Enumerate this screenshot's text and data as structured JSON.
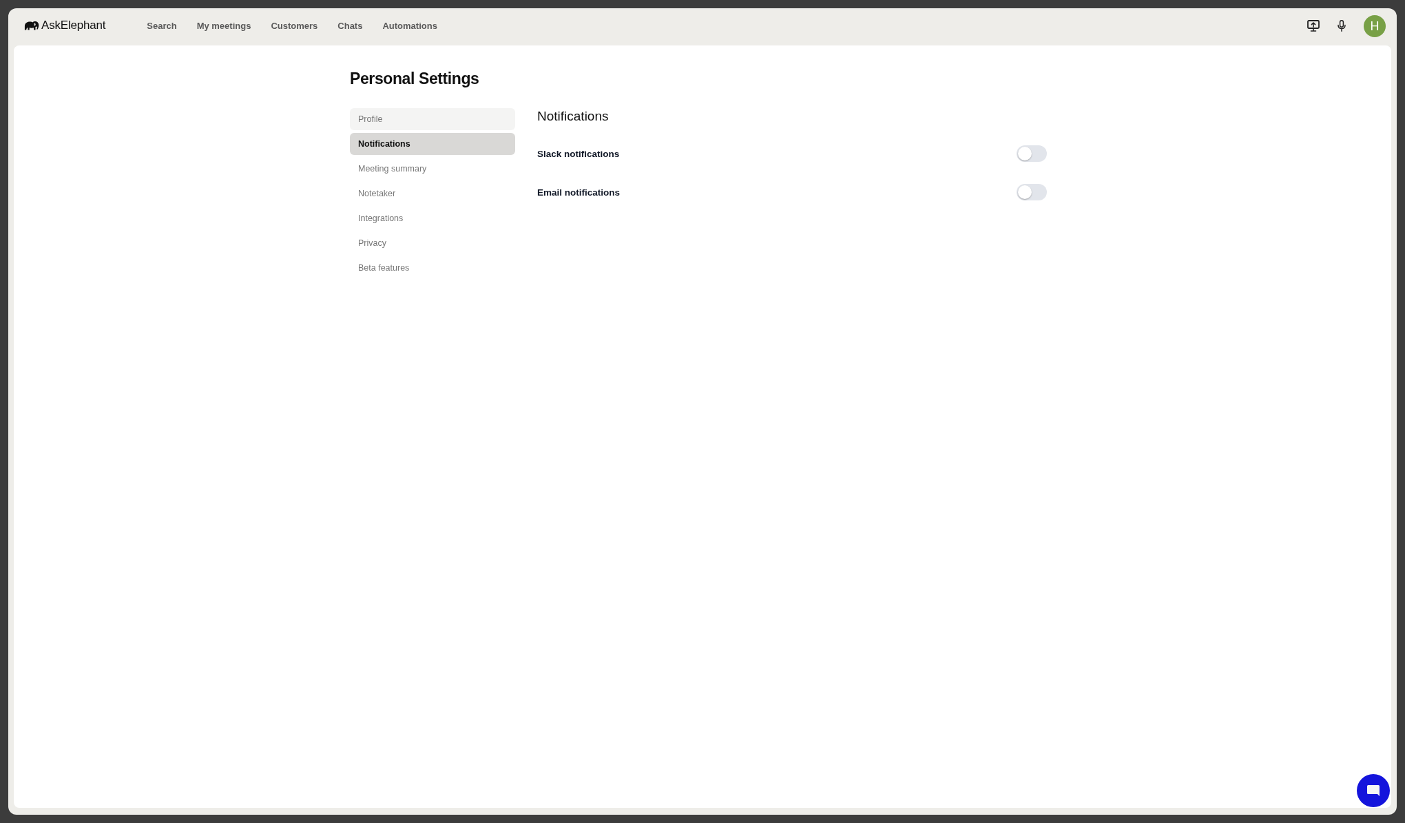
{
  "app": {
    "name": "AskElephant"
  },
  "nav": [
    "Search",
    "My meetings",
    "Customers",
    "Chats",
    "Automations"
  ],
  "user": {
    "initial": "H"
  },
  "page": {
    "title": "Personal Settings"
  },
  "sidebar": {
    "items": [
      {
        "label": "Profile",
        "selected": false,
        "hovered": true
      },
      {
        "label": "Notifications",
        "selected": true,
        "hovered": false
      },
      {
        "label": "Meeting summary",
        "selected": false,
        "hovered": false
      },
      {
        "label": "Notetaker",
        "selected": false,
        "hovered": false
      },
      {
        "label": "Integrations",
        "selected": false,
        "hovered": false
      },
      {
        "label": "Privacy",
        "selected": false,
        "hovered": false
      },
      {
        "label": "Beta features",
        "selected": false,
        "hovered": false
      }
    ]
  },
  "section": {
    "title": "Notifications",
    "settings": [
      {
        "label": "Slack notifications",
        "on": false
      },
      {
        "label": "Email notifications",
        "on": false
      }
    ]
  }
}
